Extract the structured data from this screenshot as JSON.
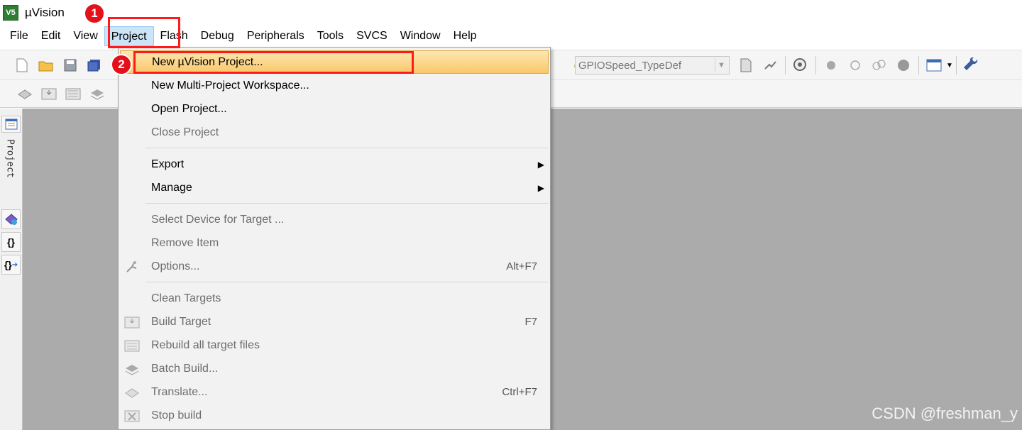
{
  "window": {
    "title": "µVision",
    "app_icon": "V5"
  },
  "menubar": {
    "items": [
      {
        "label": "File"
      },
      {
        "label": "Edit"
      },
      {
        "label": "View"
      },
      {
        "label": "Project"
      },
      {
        "label": "Flash"
      },
      {
        "label": "Debug"
      },
      {
        "label": "Peripherals"
      },
      {
        "label": "Tools"
      },
      {
        "label": "SVCS"
      },
      {
        "label": "Window"
      },
      {
        "label": "Help"
      }
    ],
    "active": "Project"
  },
  "toolbar": {
    "function_combo": "GPIOSpeed_TypeDef"
  },
  "sidebar": {
    "project_tab_label": "Project",
    "btn_braces": "{}",
    "btn_braces_arrow": "{}"
  },
  "project_menu": {
    "items": [
      {
        "label": "New µVision Project...",
        "highlighted": true
      },
      {
        "label": "New Multi-Project Workspace..."
      },
      {
        "label": "Open Project..."
      },
      {
        "label": "Close Project",
        "disabled": true
      },
      {
        "label": "Export",
        "submenu": true
      },
      {
        "label": "Manage",
        "submenu": true
      },
      {
        "label": "Select Device for Target ...",
        "disabled": true
      },
      {
        "label": "Remove Item",
        "disabled": true
      },
      {
        "label": "Options...",
        "shortcut": "Alt+F7",
        "disabled": true,
        "icon": "options-icon"
      },
      {
        "label": "Clean Targets",
        "disabled": true
      },
      {
        "label": "Build Target",
        "shortcut": "F7",
        "disabled": true,
        "icon": "build-icon"
      },
      {
        "label": "Rebuild all target files",
        "disabled": true,
        "icon": "rebuild-icon"
      },
      {
        "label": "Batch Build...",
        "disabled": true,
        "icon": "batch-build-icon"
      },
      {
        "label": "Translate...",
        "shortcut": "Ctrl+F7",
        "disabled": true,
        "icon": "translate-icon"
      },
      {
        "label": "Stop build",
        "disabled": true,
        "icon": "stop-build-icon"
      }
    ]
  },
  "annotations": {
    "step1": "1",
    "step2": "2"
  },
  "watermark": "CSDN @freshman_y",
  "colors": {
    "highlight": "#f9c86a",
    "annotation": "#ff1a1a",
    "workarea": "#ababab"
  }
}
